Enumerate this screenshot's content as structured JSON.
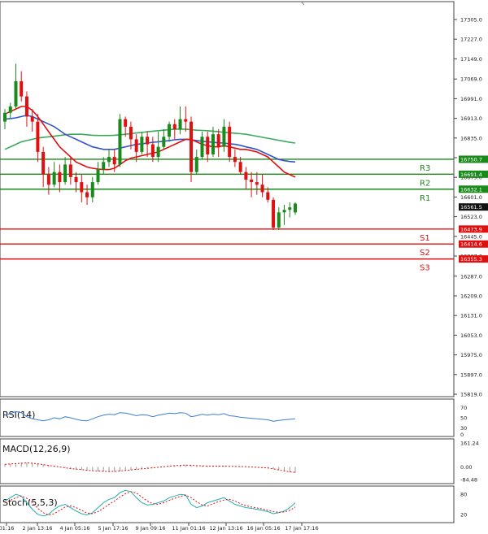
{
  "chart_data": {
    "type": "candlestick",
    "price_ticks": [
      "17305.0",
      "17227.0",
      "17149.0",
      "17069.0",
      "16991.0",
      "16913.0",
      "16835.0",
      "16757.0",
      "16679.0",
      "16601.0",
      "16523.0",
      "16445.0",
      "16367.0",
      "16287.0",
      "16209.0",
      "16131.0",
      "16053.0",
      "15975.0",
      "15897.0",
      "15819.0"
    ],
    "x_ticks": [
      "01:16",
      "2 Jan 13:16",
      "4 Jan 05:16",
      "5 Jan 17:16",
      "9 Jan 09:16",
      "11 Jan 01:16",
      "12 Jan 13:16",
      "16 Jan 05:16",
      "17 Jan 17:16"
    ],
    "current_price": "16561.5",
    "levels": [
      {
        "name": "R3",
        "value": "16750.7",
        "color": "#1a8a1a"
      },
      {
        "name": "R2",
        "value": "16691.4",
        "color": "#1a8a1a"
      },
      {
        "name": "R1",
        "value": "16632.1",
        "color": "#1a8a1a"
      },
      {
        "name": "S1",
        "value": "16473.9",
        "color": "#e01010"
      },
      {
        "name": "S2",
        "value": "16414.6",
        "color": "#e01010"
      },
      {
        "name": "S3",
        "value": "16355.3",
        "color": "#e01010"
      }
    ],
    "candles": [
      [
        16900,
        16935,
        16870,
        16950
      ],
      [
        16935,
        16960,
        16915,
        16975
      ],
      [
        16960,
        17060,
        16950,
        17130
      ],
      [
        17060,
        17000,
        16980,
        17100
      ],
      [
        17000,
        16920,
        16880,
        17020
      ],
      [
        16920,
        16900,
        16860,
        16950
      ],
      [
        16900,
        16780,
        16740,
        16930
      ],
      [
        16780,
        16690,
        16640,
        16800
      ],
      [
        16690,
        16650,
        16610,
        16720
      ],
      [
        16650,
        16700,
        16640,
        16740
      ],
      [
        16700,
        16660,
        16620,
        16730
      ],
      [
        16660,
        16730,
        16650,
        16760
      ],
      [
        16730,
        16680,
        16650,
        16760
      ],
      [
        16680,
        16660,
        16620,
        16700
      ],
      [
        16660,
        16620,
        16580,
        16690
      ],
      [
        16620,
        16600,
        16570,
        16650
      ],
      [
        16600,
        16660,
        16580,
        16680
      ],
      [
        16660,
        16710,
        16650,
        16740
      ],
      [
        16710,
        16740,
        16690,
        16760
      ],
      [
        16740,
        16760,
        16720,
        16790
      ],
      [
        16760,
        16730,
        16700,
        16790
      ],
      [
        16730,
        16910,
        16720,
        16930
      ],
      [
        16910,
        16880,
        16840,
        16920
      ],
      [
        16880,
        16830,
        16790,
        16900
      ],
      [
        16830,
        16780,
        16740,
        16850
      ],
      [
        16780,
        16840,
        16770,
        16860
      ],
      [
        16840,
        16810,
        16760,
        16860
      ],
      [
        16810,
        16760,
        16740,
        16840
      ],
      [
        16760,
        16800,
        16740,
        16860
      ],
      [
        16800,
        16840,
        16790,
        16870
      ],
      [
        16840,
        16890,
        16820,
        16900
      ],
      [
        16890,
        16870,
        16830,
        16910
      ],
      [
        16870,
        16910,
        16850,
        16960
      ],
      [
        16910,
        16900,
        16860,
        16960
      ],
      [
        16900,
        16700,
        16660,
        16920
      ],
      [
        16700,
        16760,
        16690,
        16790
      ],
      [
        16760,
        16840,
        16750,
        16860
      ],
      [
        16840,
        16770,
        16740,
        16860
      ],
      [
        16770,
        16850,
        16760,
        16880
      ],
      [
        16850,
        16800,
        16760,
        16870
      ],
      [
        16800,
        16880,
        16780,
        16910
      ],
      [
        16880,
        16760,
        16740,
        16900
      ],
      [
        16760,
        16740,
        16720,
        16790
      ],
      [
        16740,
        16700,
        16690,
        16760
      ],
      [
        16700,
        16670,
        16630,
        16720
      ],
      [
        16670,
        16660,
        16600,
        16700
      ],
      [
        16660,
        16650,
        16610,
        16700
      ],
      [
        16650,
        16620,
        16600,
        16690
      ],
      [
        16620,
        16590,
        16580,
        16640
      ],
      [
        16590,
        16480,
        16470,
        16600
      ],
      [
        16480,
        16540,
        16470,
        16560
      ],
      [
        16540,
        16550,
        16490,
        16570
      ],
      [
        16550,
        16560,
        16520,
        16580
      ],
      [
        16540,
        16575,
        16530,
        16580
      ]
    ],
    "ma_fast": [
      16930,
      16940,
      16950,
      16960,
      16960,
      16945,
      16920,
      16890,
      16860,
      16830,
      16800,
      16780,
      16760,
      16740,
      16730,
      16720,
      16715,
      16712,
      16710,
      16710,
      16715,
      16730,
      16745,
      16755,
      16760,
      16765,
      16770,
      16775,
      16780,
      16790,
      16800,
      16810,
      16820,
      16830,
      16830,
      16820,
      16810,
      16805,
      16800,
      16800,
      16805,
      16800,
      16795,
      16790,
      16790,
      16785,
      16780,
      16770,
      16760,
      16740,
      16720,
      16700,
      16690,
      16680
    ],
    "ma_mid": [
      16910,
      16912,
      16915,
      16920,
      16925,
      16920,
      16910,
      16900,
      16890,
      16880,
      16865,
      16850,
      16840,
      16830,
      16820,
      16810,
      16800,
      16795,
      16790,
      16790,
      16790,
      16795,
      16800,
      16805,
      16810,
      16812,
      16815,
      16818,
      16820,
      16822,
      16825,
      16828,
      16830,
      16830,
      16828,
      16825,
      16822,
      16820,
      16818,
      16816,
      16815,
      16812,
      16810,
      16806,
      16800,
      16795,
      16790,
      16780,
      16770,
      16760,
      16750,
      16745,
      16742,
      16740
    ],
    "ma_slow": [
      16790,
      16800,
      16810,
      16820,
      16825,
      16830,
      16835,
      16838,
      16840,
      16842,
      16845,
      16848,
      16850,
      16850,
      16850,
      16848,
      16846,
      16845,
      16845,
      16845,
      16846,
      16848,
      16850,
      16852,
      16855,
      16857,
      16860,
      16862,
      16864,
      16866,
      16868,
      16870,
      16870,
      16870,
      16868,
      16866,
      16865,
      16864,
      16862,
      16860,
      16858,
      16856,
      16854,
      16852,
      16850,
      16846,
      16842,
      16838,
      16834,
      16830,
      16826,
      16822,
      16818,
      16815
    ],
    "rsi": {
      "title": "RSI(14)",
      "ticks": [
        "70",
        "50",
        "30"
      ],
      "values": [
        55,
        58,
        62,
        60,
        52,
        48,
        46,
        44,
        46,
        50,
        48,
        52,
        50,
        47,
        45,
        44,
        48,
        52,
        55,
        57,
        56,
        60,
        59,
        57,
        54,
        56,
        55,
        52,
        55,
        57,
        59,
        58,
        60,
        59,
        52,
        54,
        57,
        55,
        57,
        56,
        58,
        54,
        53,
        51,
        50,
        49,
        48,
        47,
        46,
        43,
        45,
        46,
        47,
        48
      ]
    },
    "macd": {
      "title": "MACD(12,26,9)",
      "ticks": [
        "161.24",
        "0.00",
        "-84.48"
      ],
      "values": [
        20,
        22,
        25,
        28,
        30,
        28,
        24,
        18,
        12,
        6,
        0,
        -6,
        -12,
        -16,
        -20,
        -24,
        -28,
        -30,
        -32,
        -34,
        -33,
        -30,
        -26,
        -22,
        -18,
        -14,
        -10,
        -6,
        -2,
        2,
        6,
        10,
        12,
        14,
        12,
        10,
        8,
        7,
        6,
        6,
        6,
        5,
        4,
        3,
        2,
        0,
        -2,
        -5,
        -8,
        -14,
        -22,
        -30,
        -36,
        -40
      ]
    },
    "stoch": {
      "title": "Stoch(5,5,3)",
      "ticks": [
        "80",
        "20"
      ],
      "k": [
        60,
        70,
        80,
        75,
        55,
        35,
        20,
        15,
        20,
        35,
        45,
        50,
        40,
        30,
        22,
        18,
        25,
        40,
        55,
        65,
        70,
        85,
        92,
        88,
        70,
        55,
        48,
        50,
        55,
        60,
        70,
        75,
        80,
        78,
        50,
        40,
        45,
        55,
        60,
        65,
        70,
        60,
        50,
        45,
        40,
        38,
        35,
        32,
        28,
        22,
        25,
        30,
        40,
        55
      ],
      "d": [
        55,
        62,
        70,
        75,
        68,
        55,
        38,
        25,
        18,
        22,
        32,
        42,
        45,
        40,
        32,
        24,
        22,
        28,
        38,
        50,
        60,
        72,
        82,
        88,
        84,
        72,
        60,
        52,
        50,
        55,
        62,
        68,
        74,
        77,
        70,
        58,
        48,
        45,
        52,
        58,
        63,
        65,
        60,
        52,
        46,
        42,
        39,
        36,
        32,
        28,
        26,
        27,
        32,
        42
      ]
    }
  }
}
